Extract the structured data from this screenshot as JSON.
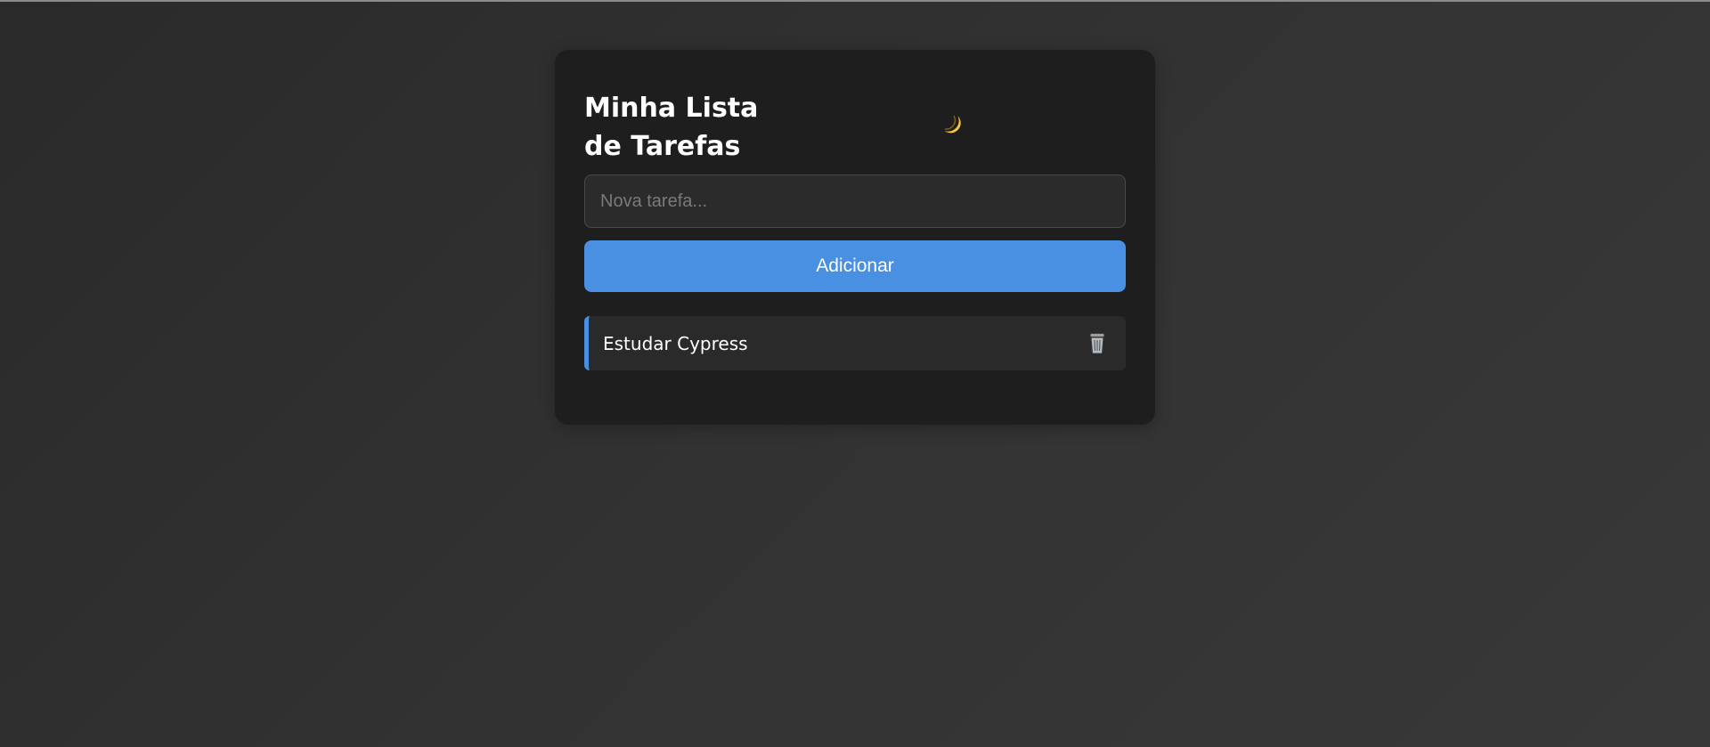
{
  "app": {
    "title": "Minha Lista de Tarefas",
    "title_line1": "Minha Lista",
    "title_line2": "de Tarefas"
  },
  "theme_toggle": {
    "icon": "moon-icon"
  },
  "form": {
    "input_value": "",
    "input_placeholder": "Nova tarefa...",
    "add_label": "Adicionar"
  },
  "tasks": [
    {
      "text": "Estudar Cypress",
      "delete_icon": "trash-icon"
    }
  ],
  "colors": {
    "accent": "#4a90e2",
    "card": "#1e1e1e",
    "background": "#333333",
    "moon": "#f6c443"
  }
}
